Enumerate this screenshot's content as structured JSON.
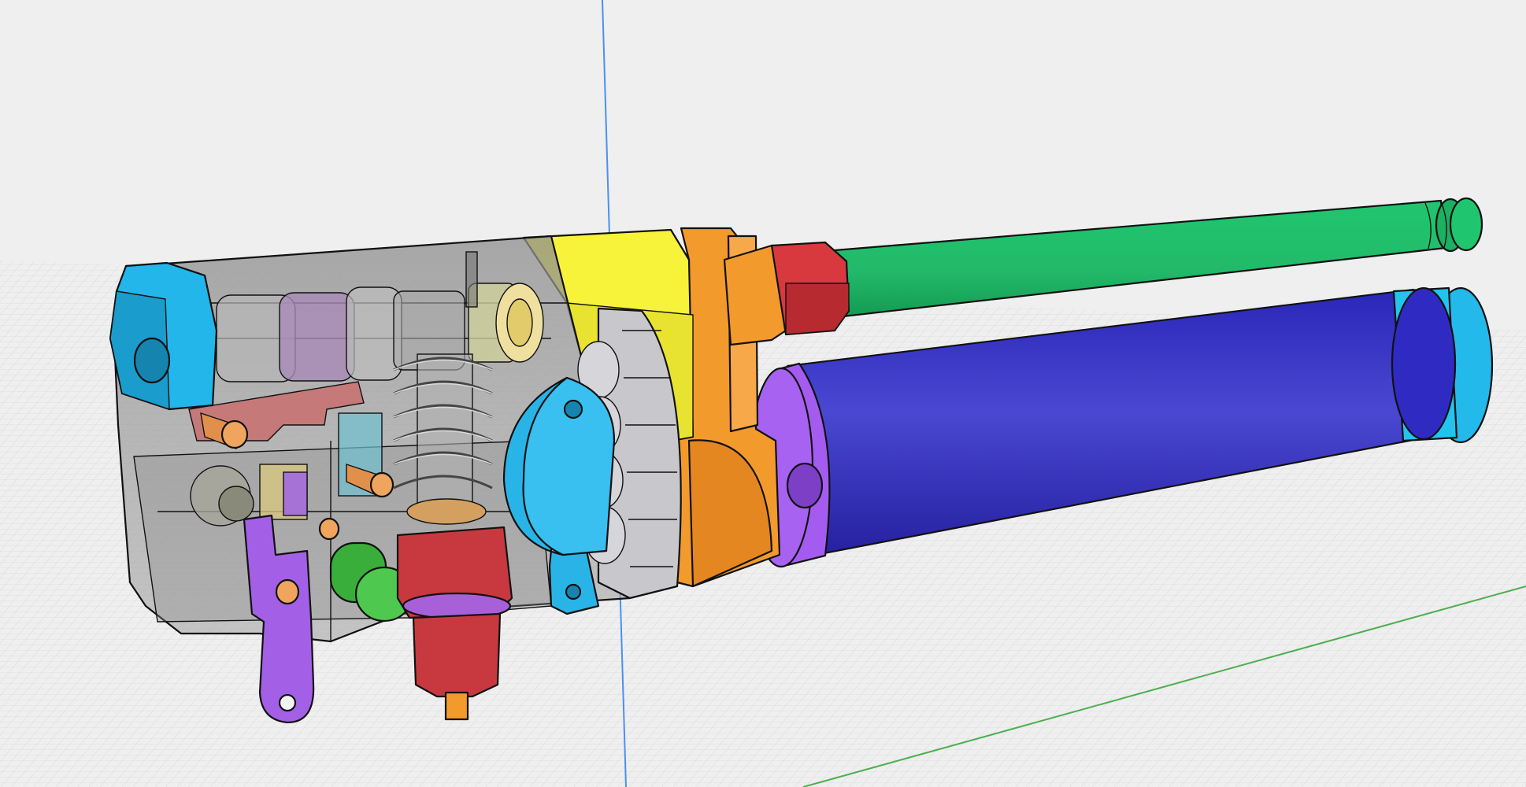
{
  "viewport": {
    "background": "#efefef",
    "grid_color": "#cfcfcf",
    "axis_colors": {
      "vertical": "#4a90f0",
      "horizontal": "#4caf50"
    }
  },
  "parts": {
    "barrel": "#1fc66f",
    "muzzle_ring": "#1fc66f",
    "tank": "#3a36c8",
    "tank_cap": "#22c4ee",
    "tank_collar": "#a45cf0",
    "barrel_nut": "#d8393f",
    "receiver_front": "#f7f23a",
    "receiver_orange": "#f39a2c",
    "end_cap": "#22b6ea",
    "housing_glass": "#9a9a9a",
    "revolver_drum": "#c8c8cc",
    "cover_plate": "#29b4e8",
    "trigger": "#a360e6",
    "valve_body": "#c8393f",
    "valve_tip": "#f39a2c",
    "button": "#4fc84f",
    "pins": "#f0a55e",
    "spring": "#b9b9b9"
  }
}
